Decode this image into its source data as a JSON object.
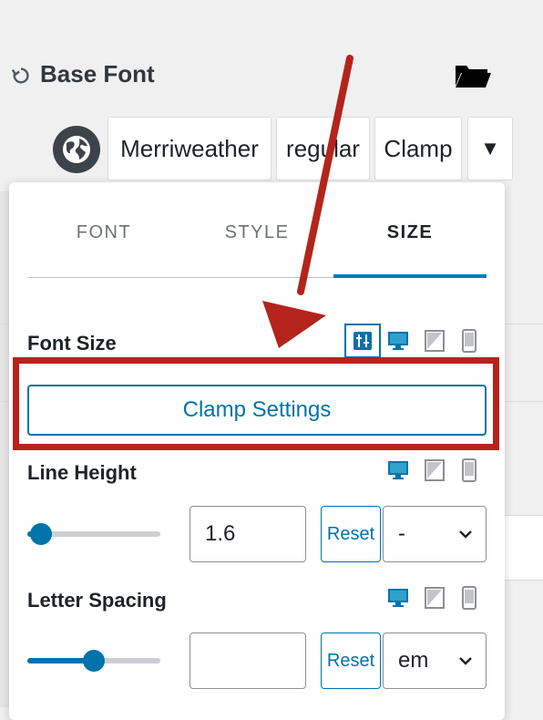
{
  "header": {
    "title": "Base Font"
  },
  "font_selector": {
    "family": "Merriweather",
    "variant": "regular",
    "size_mode": "Clamp",
    "caret": "▼"
  },
  "tabs": [
    {
      "label": "FONT",
      "active": false
    },
    {
      "label": "STYLE",
      "active": false
    },
    {
      "label": "SIZE",
      "active": true
    }
  ],
  "font_size": {
    "label": "Font Size",
    "clamp_button": "Clamp Settings"
  },
  "line_height": {
    "label": "Line Height",
    "value": "1.6",
    "reset": "Reset",
    "unit": "-",
    "slider_level": 0.1
  },
  "letter_spacing": {
    "label": "Letter Spacing",
    "value": "",
    "reset": "Reset",
    "unit": "em",
    "slider_level": 0.5
  },
  "colors": {
    "accent": "#0073aa",
    "annotation_red": "#b4241b",
    "dark_icon": "#3c434a"
  },
  "icons": [
    "reset-icon",
    "folder-icon",
    "globe-icon",
    "sliders-icon",
    "desktop-icon",
    "tablet-icon",
    "mobile-icon",
    "chevron-down-icon",
    "arrow-annotation"
  ]
}
